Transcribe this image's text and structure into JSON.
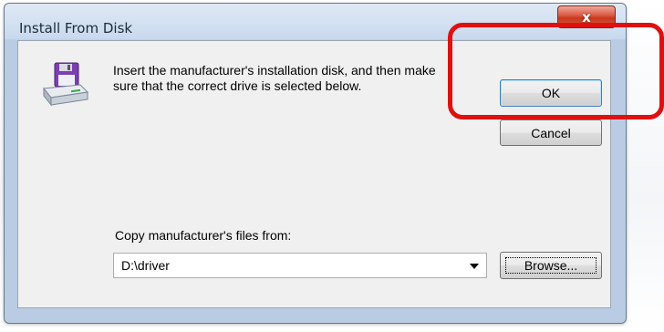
{
  "window": {
    "title": "Install From Disk",
    "close_glyph": "x"
  },
  "instructions": "Insert the manufacturer's installation disk, and then make sure that the correct drive is selected below.",
  "buttons": {
    "ok": "OK",
    "cancel": "Cancel",
    "browse": "Browse..."
  },
  "copy_from": {
    "label": "Copy manufacturer's files from:",
    "value": "D:\\driver"
  },
  "icons": {
    "disk": "install-disk-icon",
    "dropdown": "chevron-down-icon"
  },
  "colors": {
    "highlight": "#e01010",
    "close_button": "#c7381f"
  }
}
